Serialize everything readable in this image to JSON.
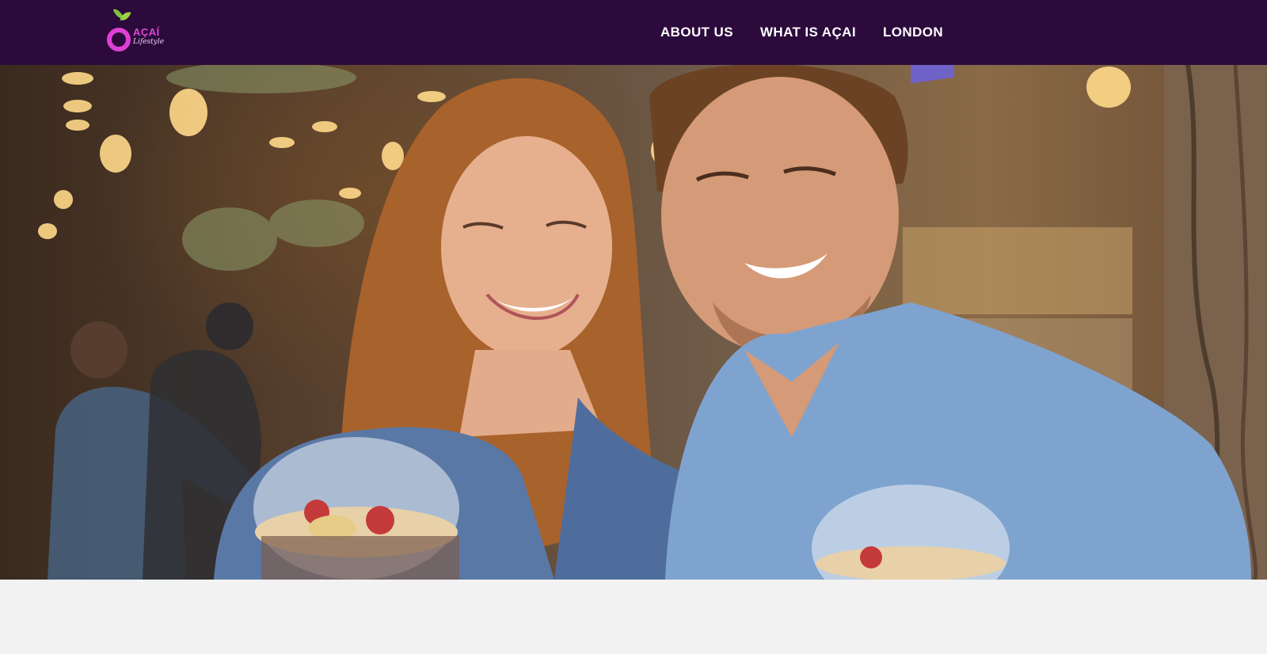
{
  "brand": {
    "logo_word": "AÇAÍ",
    "logo_script": "Lifestyle"
  },
  "nav": {
    "items": [
      {
        "label": "ABOUT US"
      },
      {
        "label": "WHAT IS AÇAI"
      },
      {
        "label": "LONDON"
      }
    ]
  },
  "colors": {
    "nav_background": "#2c0a3c",
    "nav_text": "#ffffff",
    "logo_ring": "#e03fd6",
    "logo_leaf": "#7ec242",
    "page_background": "#f2f2f2"
  },
  "hero": {
    "image": "photo-couple-holding-acai-bowls-in-cafe"
  }
}
